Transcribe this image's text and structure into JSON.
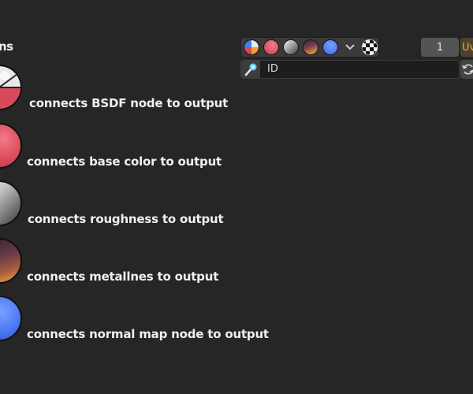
{
  "corner_text": "ns",
  "toolbar": {
    "buttons": [
      {
        "name": "bsdf-preview-button",
        "icon": "bsdf-sphere-icon"
      },
      {
        "name": "base-color-button",
        "icon": "red-sphere-icon"
      },
      {
        "name": "roughness-button",
        "icon": "gray-sphere-icon"
      },
      {
        "name": "metallic-button",
        "icon": "metal-sphere-icon"
      },
      {
        "name": "normal-button",
        "icon": "blue-sphere-icon"
      }
    ],
    "dropdown_icon": "chevron-down-icon",
    "checker_icon": "checker-icon"
  },
  "frame_value": "1",
  "uv_tab_label": "Uv",
  "search": {
    "value": "ID",
    "icon": "eyedropper-icon"
  },
  "refresh_icon": "refresh-icon",
  "items": [
    {
      "label": "connects BSDF node to output",
      "icon": "bsdf-sphere-icon"
    },
    {
      "label": "connects base color to output",
      "icon": "red-sphere-icon"
    },
    {
      "label": "connects roughness to output",
      "icon": "gray-sphere-icon"
    },
    {
      "label": "connects metallnes to output",
      "icon": "metal-sphere-icon"
    },
    {
      "label": "connects normal map node to output",
      "icon": "blue-sphere-icon"
    }
  ],
  "colors": {
    "background": "#262626",
    "base_color": "#e05060",
    "normal_blue": "#4a78f2",
    "uv_accent": "#f0a52c"
  }
}
